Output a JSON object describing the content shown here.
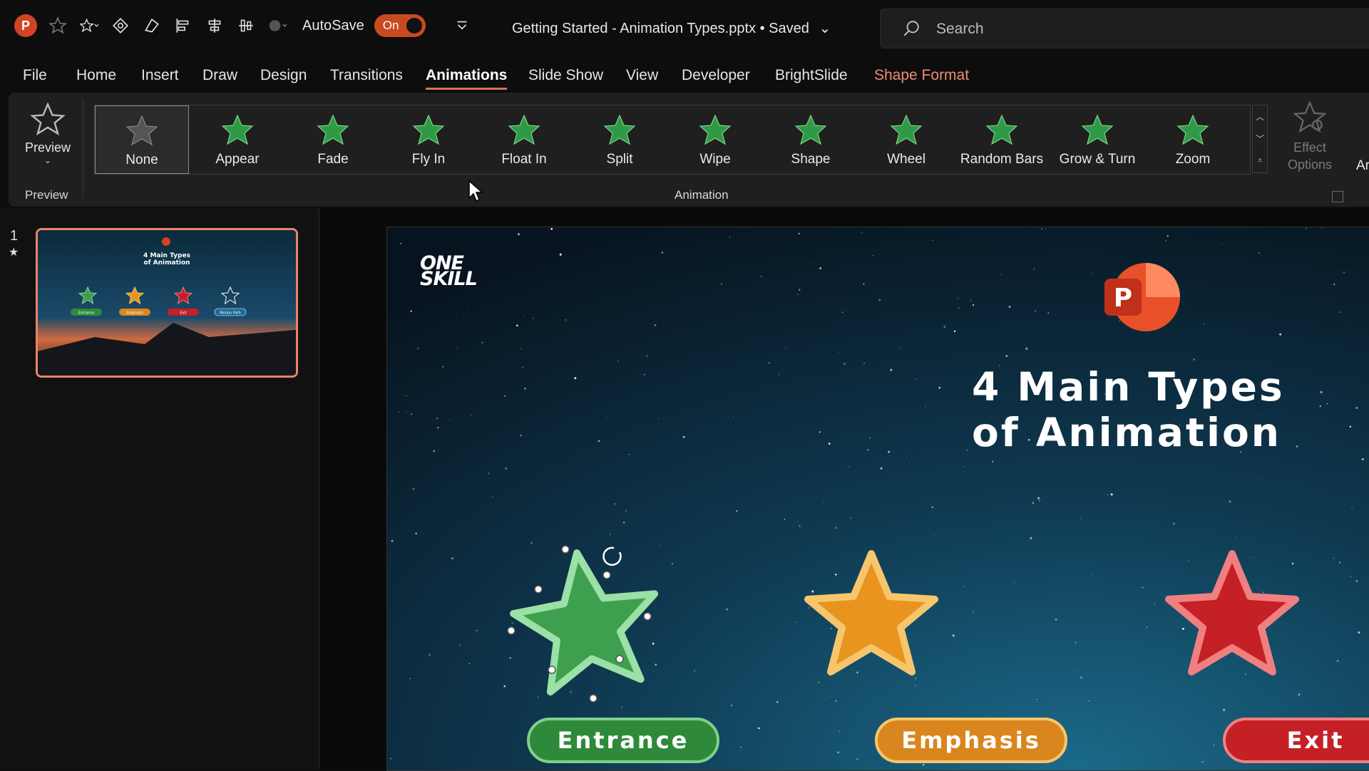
{
  "app": {
    "logo_letter": "P",
    "autosave_label": "AutoSave",
    "autosave_state": "On",
    "document_title": "Getting Started - Animation Types.pptx • Saved",
    "search_placeholder": "Search"
  },
  "tabs": [
    {
      "label": "File"
    },
    {
      "label": "Home"
    },
    {
      "label": "Insert"
    },
    {
      "label": "Draw"
    },
    {
      "label": "Design"
    },
    {
      "label": "Transitions"
    },
    {
      "label": "Animations"
    },
    {
      "label": "Slide Show"
    },
    {
      "label": "View"
    },
    {
      "label": "Developer"
    },
    {
      "label": "BrightSlide"
    },
    {
      "label": "Shape Format"
    }
  ],
  "active_tab": "Animations",
  "ribbon": {
    "preview_button": "Preview",
    "preview_group": "Preview",
    "animation_group": "Animation",
    "animations": [
      {
        "label": "None",
        "icon": "none-star-icon"
      },
      {
        "label": "Appear",
        "icon": "appear-star-icon"
      },
      {
        "label": "Fade",
        "icon": "fade-star-icon"
      },
      {
        "label": "Fly In",
        "icon": "fly-in-star-icon"
      },
      {
        "label": "Float In",
        "icon": "float-in-star-icon"
      },
      {
        "label": "Split",
        "icon": "split-star-icon"
      },
      {
        "label": "Wipe",
        "icon": "wipe-star-icon"
      },
      {
        "label": "Shape",
        "icon": "shape-star-icon"
      },
      {
        "label": "Wheel",
        "icon": "wheel-star-icon"
      },
      {
        "label": "Random Bars",
        "icon": "random-bars-star-icon"
      },
      {
        "label": "Grow & Turn",
        "icon": "grow-turn-star-icon"
      },
      {
        "label": "Zoom",
        "icon": "zoom-star-icon"
      }
    ],
    "selected_animation": "None",
    "effect_options_line1": "Effect",
    "effect_options_line2": "Options",
    "cut_off_next": "Ar"
  },
  "slides_panel": {
    "slide_number": "1",
    "thumb_title_line1": "4 Main Types",
    "thumb_title_line2": "of Animation",
    "thumb_labels": [
      "Entrance",
      "Emphasis",
      "Exit",
      "Motion Path"
    ]
  },
  "slide": {
    "logo_line1": "ONE",
    "logo_line2": "SKILL",
    "ppt_badge_letter": "P",
    "title_line1": "4 Main Types",
    "title_line2": "of Animation",
    "labels": {
      "entrance": "Entrance",
      "emphasis": "Emphasis",
      "exit": "Exit"
    }
  },
  "colors": {
    "accent": "#c94a21",
    "tab_underline": "#e07050",
    "contextual_tab": "#f08d70",
    "entrance_green": "#2e8a3a",
    "emphasis_orange": "#d9861e",
    "exit_red": "#c42026"
  }
}
